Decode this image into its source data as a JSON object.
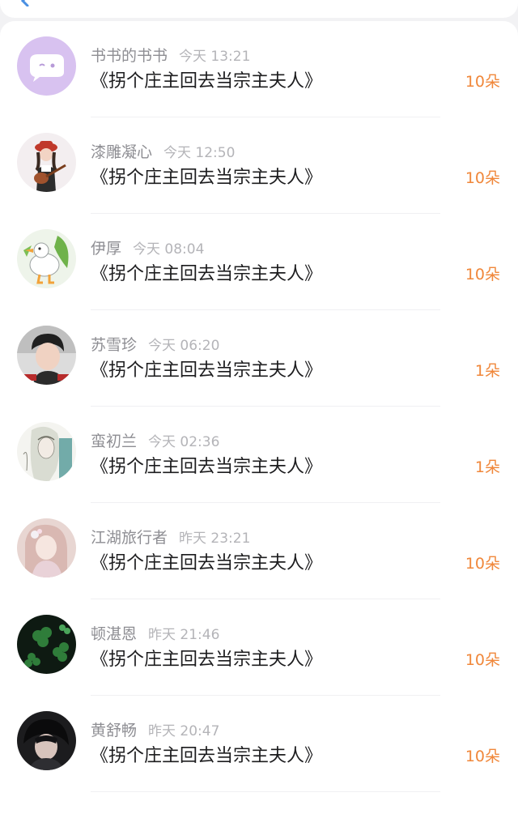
{
  "colors": {
    "amount": "#f0873a",
    "name": "#8e8e93",
    "time": "#b4b4b8",
    "title": "#1c1c1e"
  },
  "records": [
    {
      "name": "书书的书书",
      "time": "今天 13:21",
      "book": "《拐个庄主回去当宗主夫人》",
      "amount": "10朵",
      "avatar": "cartoon-face-avatar"
    },
    {
      "name": "漆雕凝心",
      "time": "今天 12:50",
      "book": "《拐个庄主回去当宗主夫人》",
      "amount": "10朵",
      "avatar": "girl-guitar-avatar"
    },
    {
      "name": "伊厚",
      "time": "今天 08:04",
      "book": "《拐个庄主回去当宗主夫人》",
      "amount": "10朵",
      "avatar": "duck-avatar"
    },
    {
      "name": "苏雪珍",
      "time": "今天 06:20",
      "book": "《拐个庄主回去当宗主夫人》",
      "amount": "1朵",
      "avatar": "boy-photo-avatar"
    },
    {
      "name": "蛮初兰",
      "time": "今天 02:36",
      "book": "《拐个庄主回去当宗主夫人》",
      "amount": "1朵",
      "avatar": "sketch-girl-avatar"
    },
    {
      "name": "江湖旅行者",
      "time": "昨天 23:21",
      "book": "《拐个庄主回去当宗主夫人》",
      "amount": "10朵",
      "avatar": "anime-girl-avatar"
    },
    {
      "name": "顿湛恩",
      "time": "昨天 21:46",
      "book": "《拐个庄主回去当宗主夫人》",
      "amount": "10朵",
      "avatar": "clover-avatar"
    },
    {
      "name": "黄舒畅",
      "time": "昨天 20:47",
      "book": "《拐个庄主回去当宗主夫人》",
      "amount": "10朵",
      "avatar": "dark-portrait-avatar"
    }
  ]
}
